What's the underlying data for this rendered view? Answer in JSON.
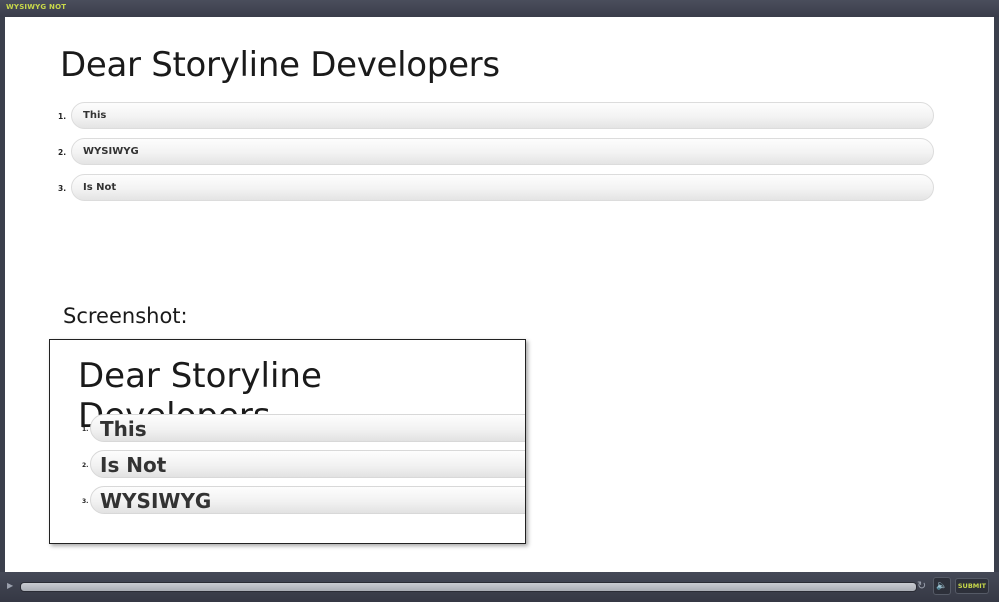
{
  "window": {
    "title": "WYSIWYG NOT"
  },
  "slide": {
    "heading": "Dear Storyline Developers",
    "sequence": [
      {
        "number": "1.",
        "label": "This"
      },
      {
        "number": "2.",
        "label": "WYSIWYG"
      },
      {
        "number": "3.",
        "label": "Is Not"
      }
    ],
    "caption": "Screenshot:",
    "screenshot": {
      "heading": "Dear Storyline Developers",
      "sequence": [
        {
          "number": "1.",
          "label": "This"
        },
        {
          "number": "2.",
          "label": "Is Not"
        },
        {
          "number": "3.",
          "label": "WYSIWYG"
        }
      ]
    }
  },
  "player": {
    "play_icon": "play-icon",
    "replay_icon": "replay-icon",
    "volume_icon": "volume-icon",
    "submit_label": "SUBMIT",
    "accent_color": "#c8d84a"
  }
}
